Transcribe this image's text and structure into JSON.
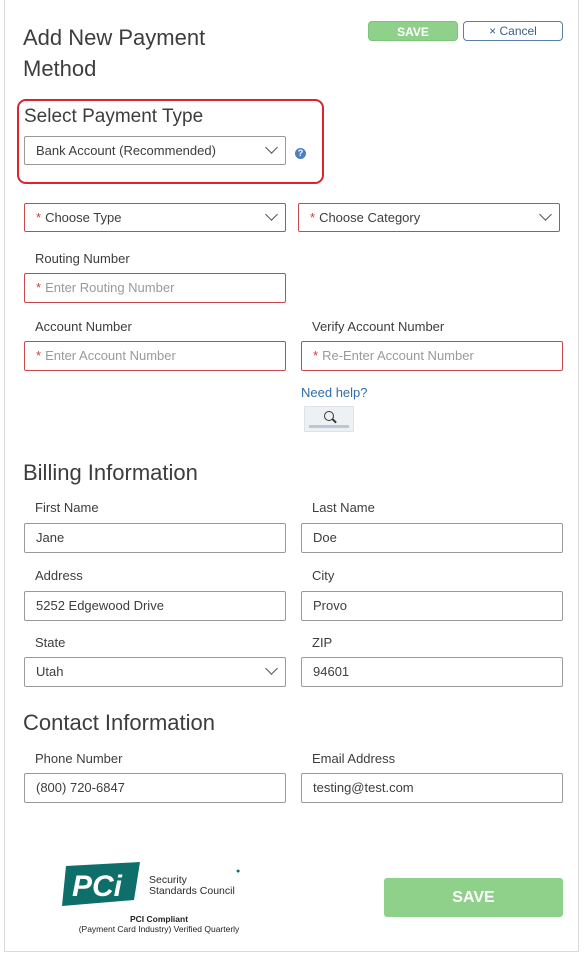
{
  "header": {
    "title": "Add New Payment Method",
    "save_label": "SAVE",
    "cancel_label": "× Cancel"
  },
  "payment_type": {
    "heading": "Select Payment Type",
    "selected": "Bank Account (Recommended)",
    "help_icon": "info-icon"
  },
  "bank": {
    "type_placeholder": "Choose Type",
    "category_placeholder": "Choose Category",
    "routing_label": "Routing Number",
    "routing_placeholder": "Enter Routing Number",
    "account_label": "Account Number",
    "account_placeholder": "Enter Account Number",
    "verify_label": "Verify Account Number",
    "verify_placeholder": "Re-Enter Account Number",
    "need_help": "Need help?"
  },
  "billing": {
    "heading": "Billing Information",
    "first_name_label": "First Name",
    "first_name": "Jane",
    "last_name_label": "Last Name",
    "last_name": "Doe",
    "address_label": "Address",
    "address": "5252 Edgewood Drive",
    "city_label": "City",
    "city": "Provo",
    "state_label": "State",
    "state": "Utah",
    "zip_label": "ZIP",
    "zip": "94601"
  },
  "contact": {
    "heading": "Contact Information",
    "phone_label": "Phone Number",
    "phone": "(800) 720-6847",
    "email_label": "Email Address",
    "email": "testing@test.com"
  },
  "footer": {
    "save_label": "SAVE",
    "pci_mark": "PCi",
    "pci_org_line1": "Security",
    "pci_org_line2": "Standards Council",
    "pci_compliant": "PCI Compliant",
    "pci_verified": "(Payment Card Industry) Verified Quarterly"
  },
  "colors": {
    "save_green": "#8fd08b",
    "required_red": "#d23b43",
    "highlight_red": "#e0222c",
    "link_blue": "#2f6ea8",
    "pci_teal": "#0e6f6a"
  }
}
